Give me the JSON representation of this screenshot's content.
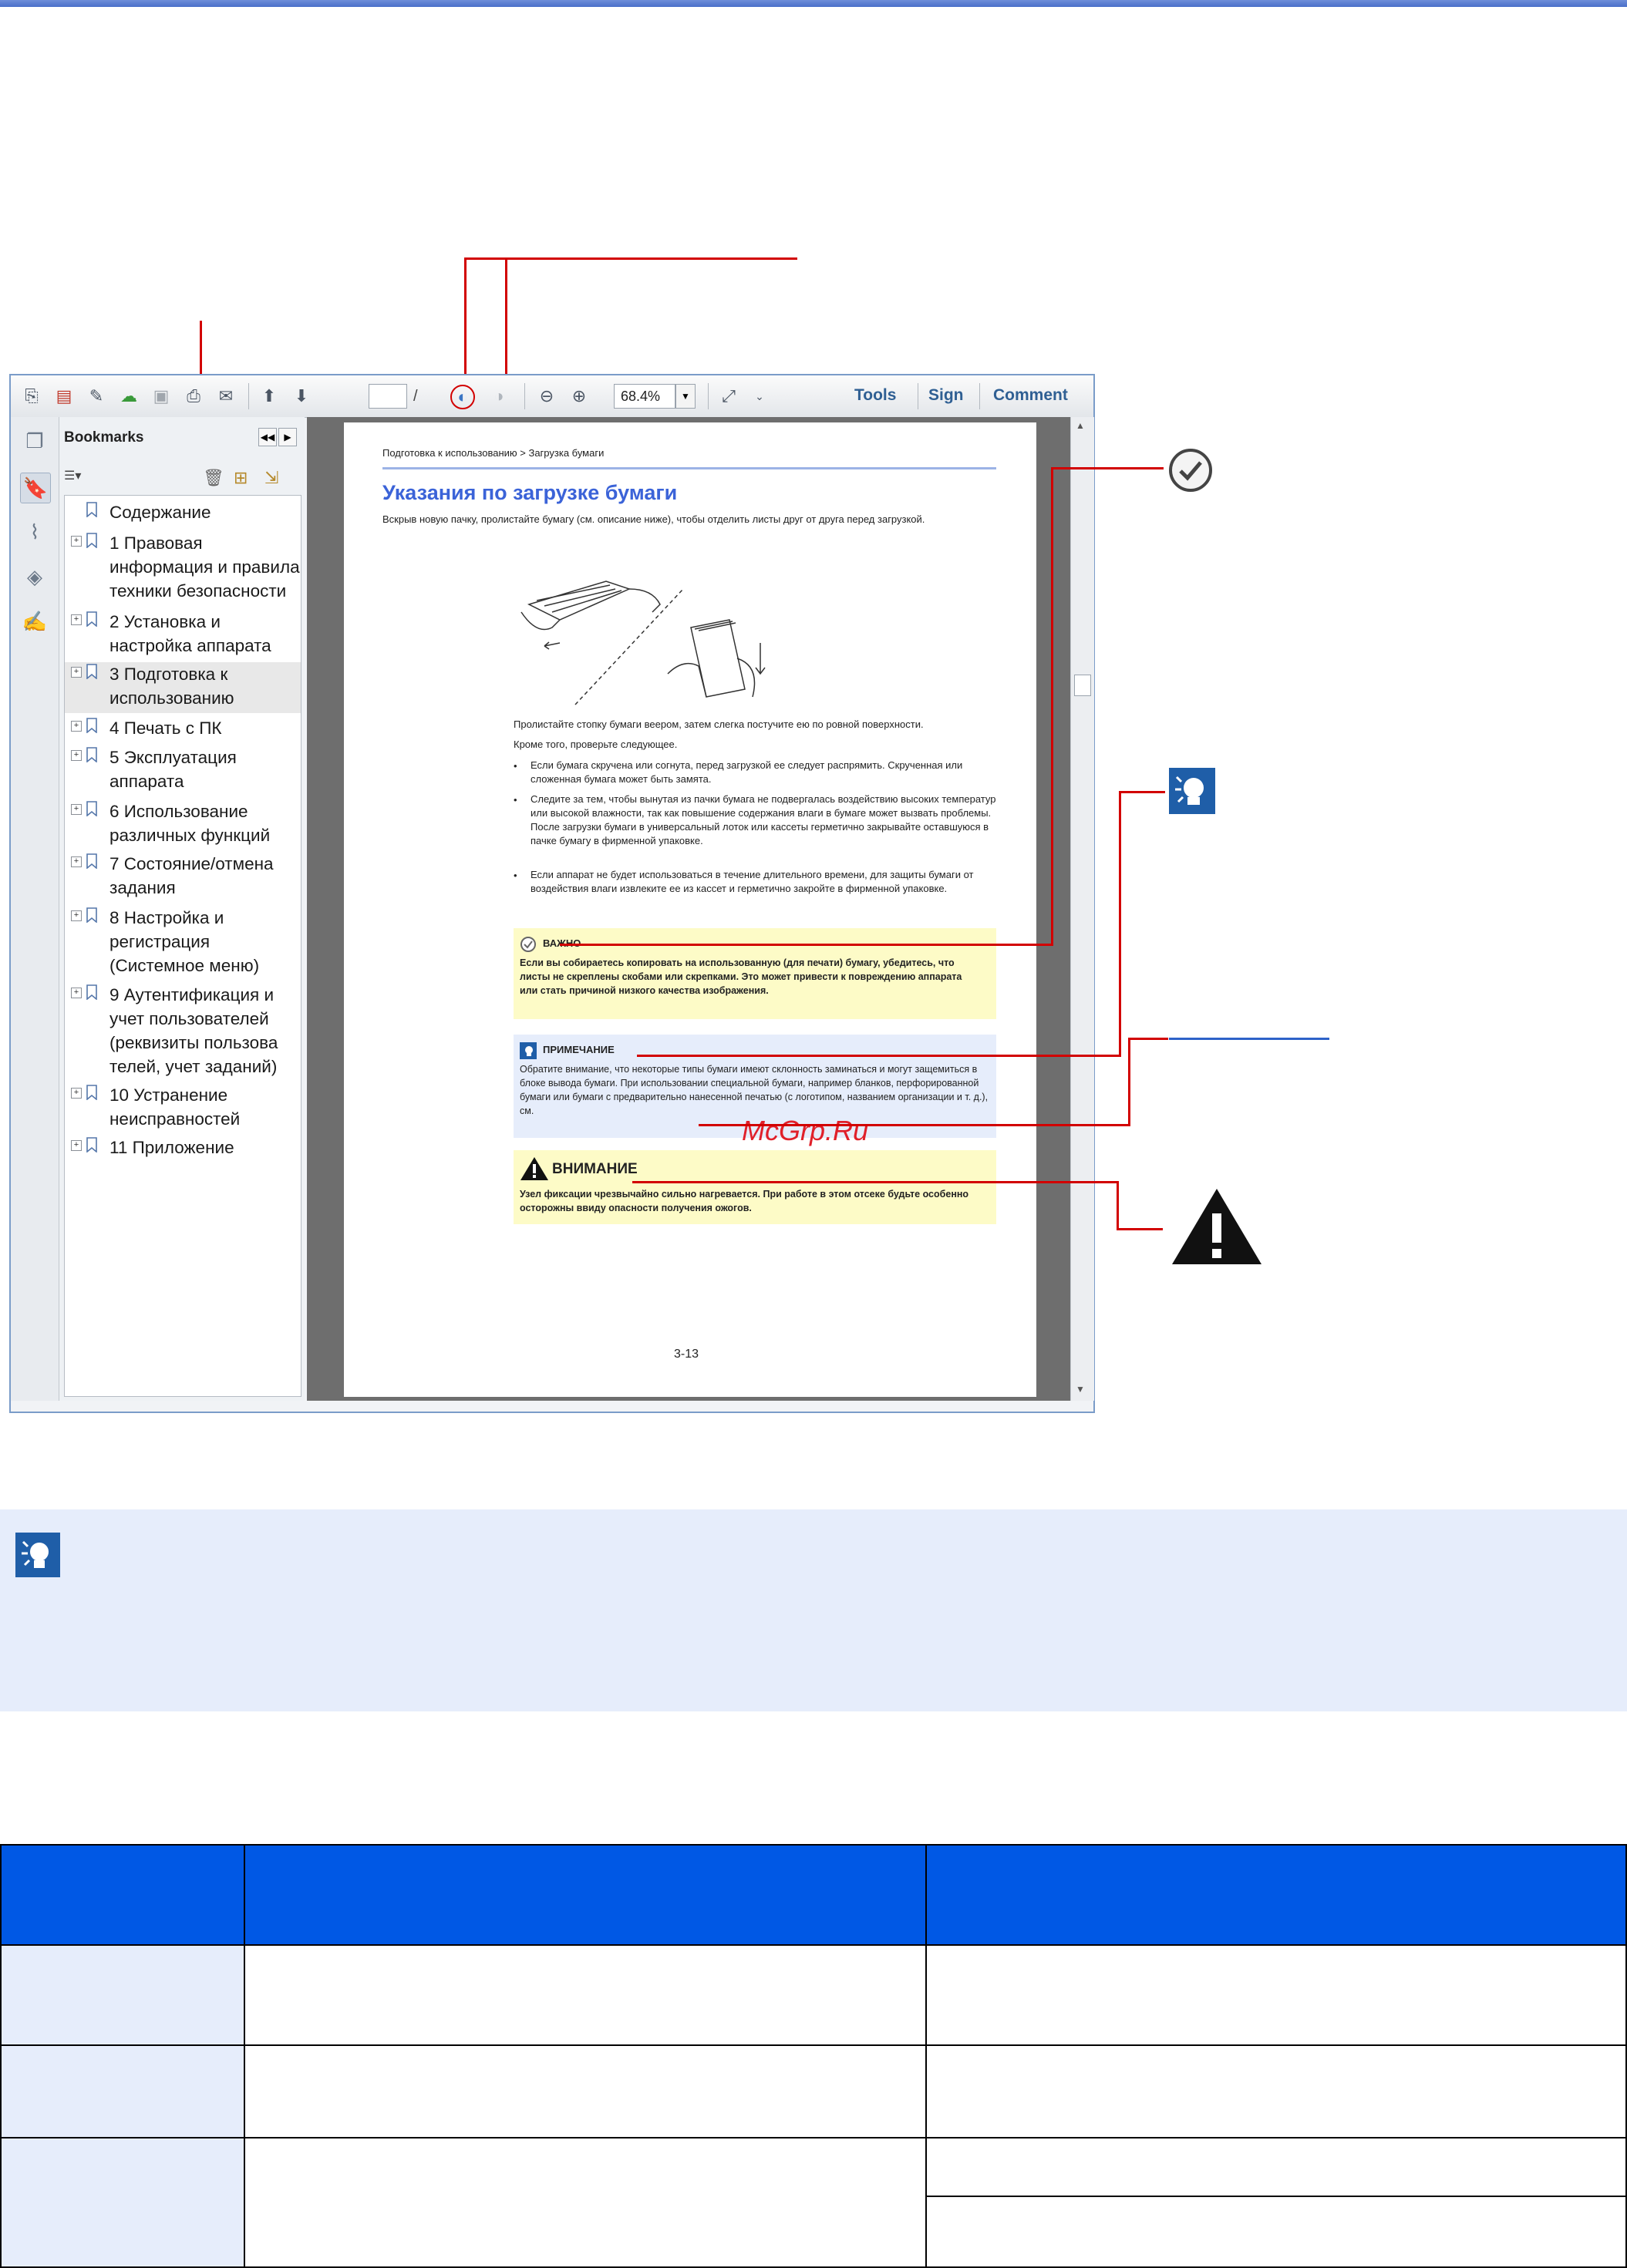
{
  "toolbar": {
    "zoom_value": "68.4%",
    "page_value": "",
    "page_sep": "/",
    "tools_label": "Tools",
    "sign_label": "Sign",
    "comment_label": "Comment"
  },
  "bookmarks": {
    "title": "Bookmarks",
    "items": [
      {
        "label": "Содержание"
      },
      {
        "label": "1 Правовая информация и правила техники безопасности"
      },
      {
        "label": "2 Установка и настройка аппарата"
      },
      {
        "label": "3 Подготовка к использованию"
      },
      {
        "label": "4 Печать с ПК"
      },
      {
        "label": "5 Эксплуатация аппарата"
      },
      {
        "label": "6 Использование различных функций"
      },
      {
        "label": "7 Состояние/отмена задания"
      },
      {
        "label": "8 Настройка и регистрация (Системное меню)"
      },
      {
        "label": "9 Аутентификация и учет пользователей (реквизиты пользова телей, учет заданий)"
      },
      {
        "label": "10 Устранение неисправностей"
      },
      {
        "label": "11 Приложение"
      }
    ]
  },
  "doc": {
    "breadcrumb": "Подготовка к использованию > Загрузка бумаги",
    "heading": "Указания по загрузке бумаги",
    "intro": "Вскрыв новую пачку, пролистайте бумагу (см. описание ниже), чтобы отделить листы друг от друга перед загрузкой.",
    "after_fig_1": "Пролистайте стопку бумаги веером, затем слегка постучите ею по ровной поверхности.",
    "after_fig_2": "Кроме того, проверьте следующее.",
    "bullets": [
      "Если бумага скручена или согнута, перед загрузкой ее следует распрямить. Скрученная или сложенная бумага может быть замята.",
      "Следите за тем, чтобы вынутая из пачки бумага не подвергалась воздействию высоких температур или высокой влажности, так как повышение содержания влаги в бумаге может вызвать проблемы. После загрузки бумаги в универсальный лоток или кассеты герметично закрывайте оставшуюся в пачке бумагу в фирменной упаковке.",
      "Если аппарат не будет использоваться в течение длительного времени, для защиты бумаги от воздействия влаги извлеките ее из кассет и герметично закройте в фирменной упаковке."
    ],
    "important_title": "ВАЖНО",
    "important_text": "Если вы собираетесь копировать на использованную (для печати) бумагу, убедитесь, что листы не скреплены скобами или скрепками. Это может привести к повреждению аппарата или стать причиной низкого качества изображения.",
    "note_title": "ПРИМЕЧАНИЕ",
    "note_text": "Обратите внимание, что некоторые типы бумаги имеют склонность заминаться и могут защемиться в блоке вывода бумаги. При использовании специальной бумаги, например бланков, перфорированной бумаги или бумаги с предварительно нанесенной печатью (с логотипом, названием организации и т. д.), см.",
    "caution_title": "ВНИМАНИЕ",
    "caution_text": "Узел фиксации чрезвычайно сильно нагревается. При работе в этом отсеке будьте особенно осторожны ввиду опасности получения ожогов.",
    "page_number": "3-13"
  },
  "watermark": "McGrp.Ru",
  "colors": {
    "callout": "#d20000",
    "heading_blue": "#3b63d8",
    "table_header": "#0058e5",
    "note_bg": "#e6edfb"
  }
}
